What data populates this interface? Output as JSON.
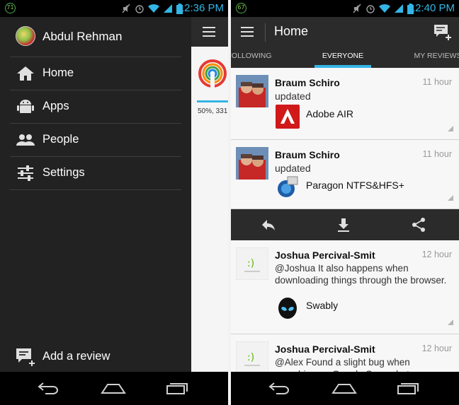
{
  "left": {
    "status": {
      "battery": "71",
      "time": "12:36 PM"
    },
    "drawer": {
      "user_name": "Abdul Rehman",
      "items": [
        {
          "label": "Home",
          "icon": "home-icon"
        },
        {
          "label": "Apps",
          "icon": "android-icon"
        },
        {
          "label": "People",
          "icon": "people-icon"
        },
        {
          "label": "Settings",
          "icon": "settings-sliders-icon"
        }
      ],
      "add_review": "Add a review"
    },
    "peek": {
      "progress_text": "50%, 331"
    }
  },
  "right": {
    "status": {
      "battery": "67",
      "time": "12:40 PM"
    },
    "actionbar": {
      "title": "Home"
    },
    "tabs": [
      "FOLLOWING",
      "EVERYONE",
      "MY REVIEWS"
    ],
    "active_tab": "EVERYONE",
    "feed": [
      {
        "author": "Braum Schiro",
        "time": "11 hour",
        "action": "updated",
        "app": "Adobe AIR"
      },
      {
        "author": "Braum Schiro",
        "time": "11 hour",
        "action": "updated",
        "app": "Paragon NTFS&HFS+"
      },
      {
        "author": "Joshua Percival-Smit",
        "time": "12 hour",
        "message": "@Joshua It also happens when downloading things through the browser.",
        "app": "Swably"
      },
      {
        "author": "Joshua Percival-Smit",
        "time": "12 hour",
        "message": "@Alex Found a slight bug when searching on Google Sourcehoto"
      }
    ],
    "action_strip": [
      "reply-icon",
      "download-icon",
      "share-icon"
    ]
  },
  "colors": {
    "accent": "#33b5e5",
    "drawer_bg": "#222222",
    "actionbar_bg": "#2b2b2b",
    "adobe_red": "#d01919"
  }
}
